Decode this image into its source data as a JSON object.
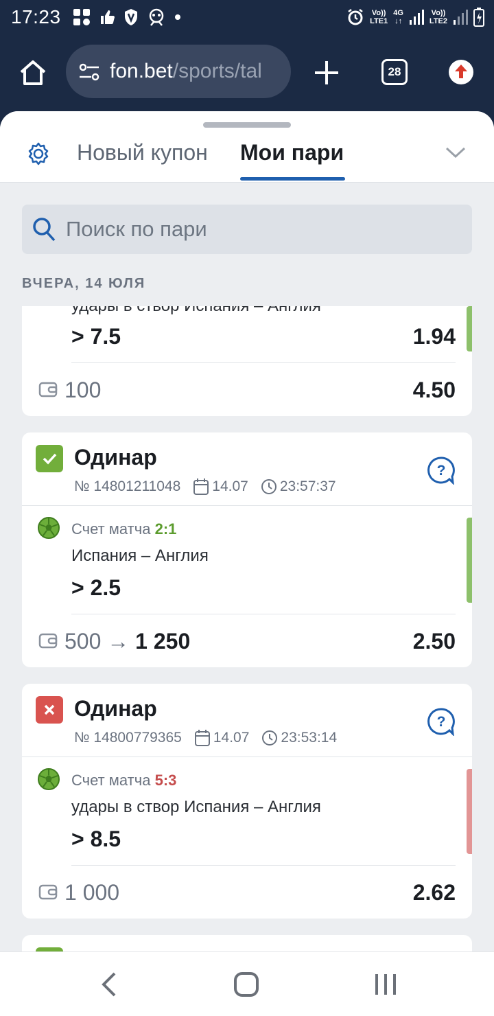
{
  "status_bar": {
    "time": "17:23",
    "sim1": "LTE1",
    "sim2": "LTE2",
    "net1": "Vo))",
    "net2": "Vo))",
    "net_4g": "4G"
  },
  "browser": {
    "url_host": "fon.bet",
    "url_path": "/sports/tal",
    "tabs_count": "28"
  },
  "sheet": {
    "tabs": [
      "Новый купон",
      "Мои пари"
    ],
    "active_tab": "Мои пари",
    "search_placeholder": "Поиск по пари",
    "date_header": "ВЧЕРА, 14 ЮЛЯ"
  },
  "bets": [
    {
      "partial": true,
      "event": "удары в створ Испания – Англия",
      "selection": "> 7.5",
      "selection_odds": "1.94",
      "stake": "100",
      "total_odds": "4.50",
      "result": "won"
    },
    {
      "type": "Одинар",
      "number": "№ 14801211048",
      "date": "14.07",
      "time": "23:57:37",
      "result": "won",
      "score_label": "Счет матча",
      "score": "2:1",
      "event": "Испания – Англия",
      "selection": "> 2.5",
      "stake": "500",
      "arrow": "→",
      "payout": "1 250",
      "total_odds": "2.50"
    },
    {
      "type": "Одинар",
      "number": "№ 14800779365",
      "date": "14.07",
      "time": "23:53:14",
      "result": "lost",
      "score_label": "Счет матча",
      "score": "5:3",
      "event": "удары в створ Испания – Англия",
      "selection": "> 8.5",
      "stake": "1 000",
      "total_odds": "2.62"
    }
  ],
  "colors": {
    "header_bg": "#1b2a44",
    "accent": "#1f5fae",
    "won": "#72ae3b",
    "lost": "#d9534f",
    "sheet_bg": "#eceef1"
  }
}
